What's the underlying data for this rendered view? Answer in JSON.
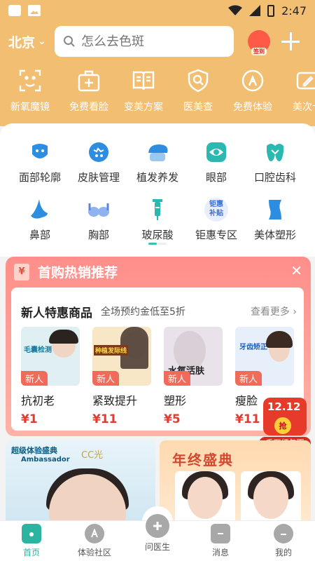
{
  "status_bar": {
    "time": "2:47"
  },
  "header": {
    "city": "北京",
    "search_placeholder": "怎么去色斑",
    "signin_label": "签到"
  },
  "quick_actions": [
    {
      "label": "新氧魔镜",
      "icon": "face-scan-icon"
    },
    {
      "label": "免费看脸",
      "icon": "medical-bag-icon"
    },
    {
      "label": "变美方案",
      "icon": "book-icon"
    },
    {
      "label": "医美查",
      "icon": "shield-search-icon"
    },
    {
      "label": "免费体验",
      "icon": "experience-icon"
    },
    {
      "label": "美次卡",
      "icon": "card-edit-icon"
    }
  ],
  "categories": [
    {
      "label": "面部轮廓",
      "icon": "face-contour-icon"
    },
    {
      "label": "皮肤管理",
      "icon": "skin-care-icon"
    },
    {
      "label": "植发养发",
      "icon": "hair-icon"
    },
    {
      "label": "眼部",
      "icon": "eye-icon"
    },
    {
      "label": "口腔齿科",
      "icon": "tooth-icon"
    },
    {
      "label": "鼻部",
      "icon": "nose-icon"
    },
    {
      "label": "胸部",
      "icon": "chest-icon"
    },
    {
      "label": "玻尿酸",
      "icon": "syringe-icon"
    },
    {
      "label": "钜惠专区",
      "icon": "discount-icon",
      "icon_text": "钜惠\n补贴"
    },
    {
      "label": "美体塑形",
      "icon": "body-shape-icon"
    }
  ],
  "promo": {
    "title": "首购热销推荐",
    "yen": "¥",
    "card_title": "新人特惠商品",
    "card_subtitle": "全场预约金低至5折",
    "more": "查看更多 ›",
    "products": [
      {
        "name": "抗初老",
        "price": "¥1",
        "badge": "新人",
        "thumb_text": "毛囊检测"
      },
      {
        "name": "紧致提升",
        "price": "¥11",
        "badge": "新人",
        "thumb_text": "种植发际线"
      },
      {
        "name": "塑形",
        "price": "¥5",
        "badge": "新人",
        "thumb_text": "水氧活肤"
      },
      {
        "name": "瘦脸",
        "price": "¥11",
        "badge": "新人",
        "thumb_text": "牙齿矫正"
      }
    ]
  },
  "floating_red_packet": {
    "date": "12.12",
    "coin": "抢",
    "ribbon": "千万红包雨"
  },
  "banners": {
    "left": {
      "brand": "超级体验盛典",
      "brand_sub": "Ambassador",
      "partner": "CC光"
    },
    "right": {
      "title": "年终盛典"
    }
  },
  "tab_bar": [
    {
      "label": "首页",
      "icon": "home-icon",
      "active": true
    },
    {
      "label": "体验社区",
      "icon": "community-icon"
    },
    {
      "label": "问医生",
      "icon": "doctor-icon"
    },
    {
      "label": "消息",
      "icon": "message-icon"
    },
    {
      "label": "我的",
      "icon": "profile-icon"
    }
  ],
  "colors": {
    "header_bg": "#f2bf72",
    "accent": "#2bb5a0",
    "promo_red": "#ff8e8a",
    "price_red": "#e23b2f"
  }
}
